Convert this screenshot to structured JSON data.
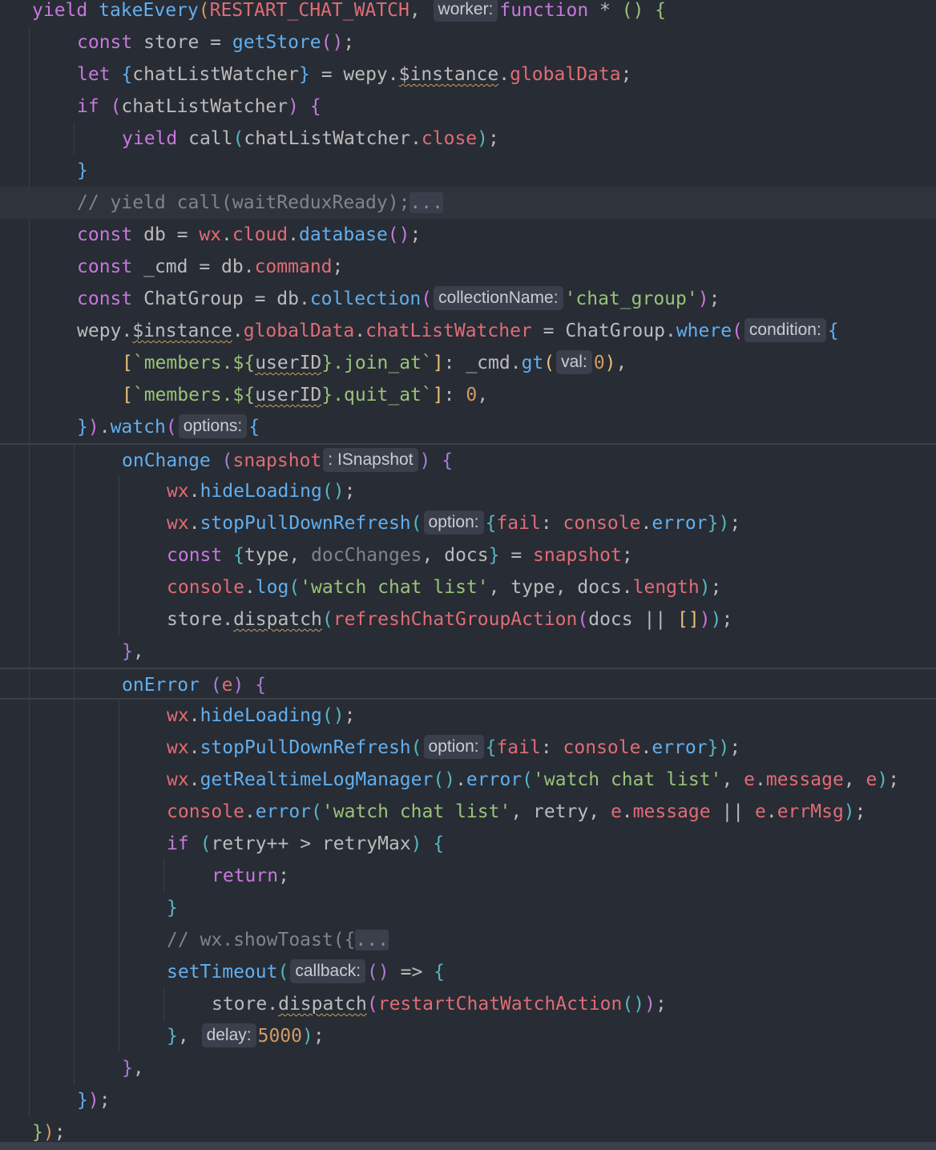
{
  "editor": {
    "language": "javascript",
    "theme": "dark",
    "lines": [
      [
        [
          "kw",
          "yield"
        ],
        [
          "pl",
          " "
        ],
        [
          "fn",
          "takeEvery"
        ],
        [
          "b1",
          "("
        ],
        [
          "prop",
          "RESTART_CHAT_WATCH"
        ],
        [
          "pl",
          ", "
        ],
        [
          "hint",
          "worker:"
        ],
        [
          "kw",
          "function"
        ],
        [
          "pl",
          " * "
        ],
        [
          "bY",
          "()"
        ],
        [
          "pl",
          " "
        ],
        [
          "bY",
          "{"
        ]
      ],
      [
        [
          "kw",
          "const"
        ],
        [
          "pl",
          " store = "
        ],
        [
          "fn",
          "getStore"
        ],
        [
          "b2",
          "()"
        ],
        [
          "pl",
          ";"
        ]
      ],
      [
        [
          "kw",
          "let"
        ],
        [
          "pl",
          " "
        ],
        [
          "bBlue",
          "{"
        ],
        [
          "pl",
          "chatListWatcher"
        ],
        [
          "bBlue",
          "}"
        ],
        [
          "pl",
          " = wepy."
        ],
        [
          "wavy",
          "$instance"
        ],
        [
          "pl",
          "."
        ],
        [
          "prop",
          "globalData"
        ],
        [
          "pl",
          ";"
        ]
      ],
      [
        [
          "kw",
          "if"
        ],
        [
          "pl",
          " "
        ],
        [
          "b2",
          "("
        ],
        [
          "pl",
          "chatListWatcher"
        ],
        [
          "b2",
          ")"
        ],
        [
          "pl",
          " "
        ],
        [
          "b2",
          "{"
        ]
      ],
      [
        [
          "kw",
          "yield"
        ],
        [
          "pl",
          " call"
        ],
        [
          "b3",
          "("
        ],
        [
          "pl",
          "chatListWatcher."
        ],
        [
          "prop",
          "close"
        ],
        [
          "b3",
          ")"
        ],
        [
          "pl",
          ";"
        ]
      ],
      [
        [
          "bBlue",
          "}"
        ]
      ],
      [
        [
          "cm",
          "// yield call(waitReduxReady);"
        ],
        [
          "fold",
          "..."
        ]
      ],
      [
        [
          "kw",
          "const"
        ],
        [
          "pl",
          " db = "
        ],
        [
          "prop",
          "wx"
        ],
        [
          "pl",
          "."
        ],
        [
          "prop",
          "cloud"
        ],
        [
          "pl",
          "."
        ],
        [
          "fn",
          "database"
        ],
        [
          "b2",
          "()"
        ],
        [
          "pl",
          ";"
        ]
      ],
      [
        [
          "kw",
          "const"
        ],
        [
          "pl",
          " _cmd = db."
        ],
        [
          "prop",
          "command"
        ],
        [
          "pl",
          ";"
        ]
      ],
      [
        [
          "kw",
          "const"
        ],
        [
          "pl",
          " ChatGroup = db."
        ],
        [
          "fn",
          "collection"
        ],
        [
          "b2",
          "("
        ],
        [
          "hint",
          "collectionName:"
        ],
        [
          "str",
          "'chat_group'"
        ],
        [
          "b2",
          ")"
        ],
        [
          "pl",
          ";"
        ]
      ],
      [
        [
          "pl",
          "wepy."
        ],
        [
          "wavy",
          "$instance"
        ],
        [
          "pl",
          "."
        ],
        [
          "prop",
          "globalData"
        ],
        [
          "pl",
          "."
        ],
        [
          "prop",
          "chatListWatcher"
        ],
        [
          "pl",
          " = ChatGroup."
        ],
        [
          "fn",
          "where"
        ],
        [
          "b2",
          "("
        ],
        [
          "hint",
          "condition:"
        ],
        [
          "bBlue",
          "{"
        ]
      ],
      [
        [
          "b4",
          "["
        ],
        [
          "tmpl",
          "`members.${"
        ],
        [
          "wavy",
          "userID"
        ],
        [
          "tmpl",
          "}.join_at`"
        ],
        [
          "b4",
          "]"
        ],
        [
          "pl",
          ": _cmd."
        ],
        [
          "fn",
          "gt"
        ],
        [
          "b4",
          "("
        ],
        [
          "hint",
          "val:"
        ],
        [
          "num",
          "0"
        ],
        [
          "b4",
          ")"
        ],
        [
          "pl",
          ","
        ]
      ],
      [
        [
          "b4",
          "["
        ],
        [
          "tmpl",
          "`members.${"
        ],
        [
          "wavy",
          "userID"
        ],
        [
          "tmpl",
          "}.quit_at`"
        ],
        [
          "b4",
          "]"
        ],
        [
          "pl",
          ": "
        ],
        [
          "num",
          "0"
        ],
        [
          "pl",
          ","
        ]
      ],
      [
        [
          "bBlue",
          "}"
        ],
        [
          "b2",
          ")"
        ],
        [
          "pl",
          "."
        ],
        [
          "fn",
          "watch"
        ],
        [
          "b2",
          "("
        ],
        [
          "hint",
          "options:"
        ],
        [
          "bBlue",
          "{"
        ]
      ],
      [
        [
          "fn",
          "onChange"
        ],
        [
          "pl",
          " "
        ],
        [
          "bPurp",
          "("
        ],
        [
          "prop",
          "snapshot"
        ],
        [
          "hint",
          ": ISnapshot"
        ],
        [
          "bPurp",
          ")"
        ],
        [
          "pl",
          " "
        ],
        [
          "bPurp",
          "{"
        ]
      ],
      [
        [
          "prop",
          "wx"
        ],
        [
          "pl",
          "."
        ],
        [
          "fn",
          "hideLoading"
        ],
        [
          "b3",
          "()"
        ],
        [
          "pl",
          ";"
        ]
      ],
      [
        [
          "prop",
          "wx"
        ],
        [
          "pl",
          "."
        ],
        [
          "fn",
          "stopPullDownRefresh"
        ],
        [
          "b3",
          "("
        ],
        [
          "hint",
          "option:"
        ],
        [
          "b3",
          "{"
        ],
        [
          "prop",
          "fail"
        ],
        [
          "pl",
          ": "
        ],
        [
          "prop",
          "console"
        ],
        [
          "pl",
          "."
        ],
        [
          "fn",
          "error"
        ],
        [
          "b3",
          "}"
        ],
        [
          "b3",
          ")"
        ],
        [
          "pl",
          ";"
        ]
      ],
      [
        [
          "kw",
          "const"
        ],
        [
          "pl",
          " "
        ],
        [
          "b3",
          "{"
        ],
        [
          "pl",
          "type, "
        ],
        [
          "dim",
          "docChanges"
        ],
        [
          "pl",
          ", docs"
        ],
        [
          "b3",
          "}"
        ],
        [
          "pl",
          " = "
        ],
        [
          "prop",
          "snapshot"
        ],
        [
          "pl",
          ";"
        ]
      ],
      [
        [
          "prop",
          "console"
        ],
        [
          "pl",
          "."
        ],
        [
          "fn",
          "log"
        ],
        [
          "b3",
          "("
        ],
        [
          "str",
          "'watch chat list'"
        ],
        [
          "pl",
          ", type, docs."
        ],
        [
          "prop",
          "length"
        ],
        [
          "b3",
          ")"
        ],
        [
          "pl",
          ";"
        ]
      ],
      [
        [
          "pl",
          "store."
        ],
        [
          "wavy",
          "dispatch"
        ],
        [
          "b3",
          "("
        ],
        [
          "prop",
          "refreshChatGroupAction"
        ],
        [
          "b2",
          "("
        ],
        [
          "pl",
          "docs || "
        ],
        [
          "b4",
          "[]"
        ],
        [
          "b2",
          ")"
        ],
        [
          "b3",
          ")"
        ],
        [
          "pl",
          ";"
        ]
      ],
      [
        [
          "bPurp",
          "}"
        ],
        [
          "pl",
          ","
        ]
      ],
      [
        [
          "fn",
          "onError"
        ],
        [
          "pl",
          " "
        ],
        [
          "bPurp",
          "("
        ],
        [
          "prop",
          "e"
        ],
        [
          "bPurp",
          ")"
        ],
        [
          "pl",
          " "
        ],
        [
          "bPurp",
          "{"
        ]
      ],
      [
        [
          "prop",
          "wx"
        ],
        [
          "pl",
          "."
        ],
        [
          "fn",
          "hideLoading"
        ],
        [
          "b3",
          "()"
        ],
        [
          "pl",
          ";"
        ]
      ],
      [
        [
          "prop",
          "wx"
        ],
        [
          "pl",
          "."
        ],
        [
          "fn",
          "stopPullDownRefresh"
        ],
        [
          "b3",
          "("
        ],
        [
          "hint",
          "option:"
        ],
        [
          "b3",
          "{"
        ],
        [
          "prop",
          "fail"
        ],
        [
          "pl",
          ": "
        ],
        [
          "prop",
          "console"
        ],
        [
          "pl",
          "."
        ],
        [
          "fn",
          "error"
        ],
        [
          "b3",
          "}"
        ],
        [
          "b3",
          ")"
        ],
        [
          "pl",
          ";"
        ]
      ],
      [
        [
          "prop",
          "wx"
        ],
        [
          "pl",
          "."
        ],
        [
          "fn",
          "getRealtimeLogManager"
        ],
        [
          "b3",
          "()"
        ],
        [
          "pl",
          "."
        ],
        [
          "fn",
          "error"
        ],
        [
          "b3",
          "("
        ],
        [
          "str",
          "'watch chat list'"
        ],
        [
          "pl",
          ", "
        ],
        [
          "prop",
          "e"
        ],
        [
          "pl",
          "."
        ],
        [
          "prop",
          "message"
        ],
        [
          "pl",
          ", "
        ],
        [
          "prop",
          "e"
        ],
        [
          "b3",
          ")"
        ],
        [
          "pl",
          ";"
        ]
      ],
      [
        [
          "prop",
          "console"
        ],
        [
          "pl",
          "."
        ],
        [
          "fn",
          "error"
        ],
        [
          "b3",
          "("
        ],
        [
          "str",
          "'watch chat list'"
        ],
        [
          "pl",
          ", retry, "
        ],
        [
          "prop",
          "e"
        ],
        [
          "pl",
          "."
        ],
        [
          "prop",
          "message"
        ],
        [
          "pl",
          " || "
        ],
        [
          "prop",
          "e"
        ],
        [
          "pl",
          "."
        ],
        [
          "prop",
          "errMsg"
        ],
        [
          "b3",
          ")"
        ],
        [
          "pl",
          ";"
        ]
      ],
      [
        [
          "kw",
          "if"
        ],
        [
          "pl",
          " "
        ],
        [
          "b3",
          "("
        ],
        [
          "pl",
          "retry++ > retryMax"
        ],
        [
          "b3",
          ")"
        ],
        [
          "pl",
          " "
        ],
        [
          "b3",
          "{"
        ]
      ],
      [
        [
          "kw",
          "return"
        ],
        [
          "pl",
          ";"
        ]
      ],
      [
        [
          "b3",
          "}"
        ]
      ],
      [
        [
          "cm",
          "// wx.showToast({"
        ],
        [
          "fold",
          "..."
        ]
      ],
      [
        [
          "fn",
          "setTimeout"
        ],
        [
          "b3",
          "("
        ],
        [
          "hint",
          "callback:"
        ],
        [
          "bPurp",
          "()"
        ],
        [
          "pl",
          " => "
        ],
        [
          "b3",
          "{"
        ]
      ],
      [
        [
          "pl",
          "store."
        ],
        [
          "wavy",
          "dispatch"
        ],
        [
          "b2",
          "("
        ],
        [
          "prop",
          "restartChatWatchAction"
        ],
        [
          "b3",
          "()"
        ],
        [
          "b2",
          ")"
        ],
        [
          "pl",
          ";"
        ]
      ],
      [
        [
          "b3",
          "}"
        ],
        [
          "pl",
          ", "
        ],
        [
          "hint",
          "delay:"
        ],
        [
          "num",
          "5000"
        ],
        [
          "b3",
          ")"
        ],
        [
          "pl",
          ";"
        ]
      ],
      [
        [
          "bPurp",
          "}"
        ],
        [
          "pl",
          ","
        ]
      ],
      [
        [
          "bBlue",
          "}"
        ],
        [
          "b2",
          ")"
        ],
        [
          "pl",
          ";"
        ]
      ],
      [
        [
          "bY",
          "}"
        ],
        [
          "b1",
          ")"
        ],
        [
          "pl",
          ";"
        ]
      ]
    ]
  }
}
